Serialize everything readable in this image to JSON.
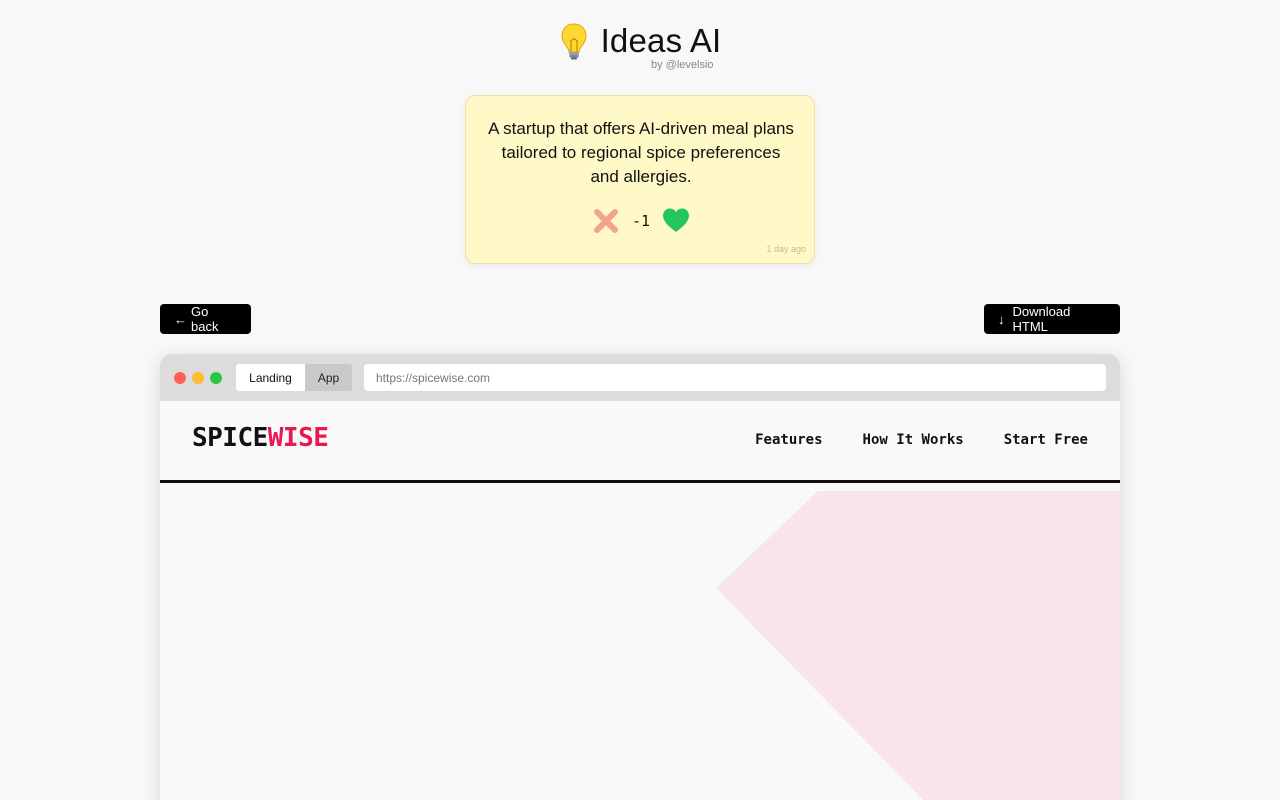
{
  "header": {
    "title": "Ideas AI",
    "byline": "by @levelsio",
    "icon": "lightbulb-icon"
  },
  "idea": {
    "text": "A startup that offers AI-driven meal plans tailored to regional spice preferences and allergies.",
    "vote_count": "-1",
    "timestamp": "1 day ago",
    "downvote_icon": "cross-icon",
    "upvote_icon": "heart-icon"
  },
  "actions": {
    "back_label": "Go back",
    "back_icon": "←",
    "download_label": "Download HTML",
    "download_icon": "↓"
  },
  "browser": {
    "tabs": [
      {
        "label": "Landing",
        "active": true
      },
      {
        "label": "App",
        "active": false
      }
    ],
    "url": "https://spicewise.com"
  },
  "site": {
    "logo_part1": "SPICE",
    "logo_part2": "WISE",
    "nav": [
      {
        "label": "Features"
      },
      {
        "label": "How It Works"
      },
      {
        "label": "Start Free"
      }
    ]
  },
  "colors": {
    "accent": "#e8194f",
    "card_bg": "#fef9c7",
    "upvote": "#22c55e",
    "downvote": "#f4a38c",
    "hero_shape": "#f9e4e9"
  }
}
